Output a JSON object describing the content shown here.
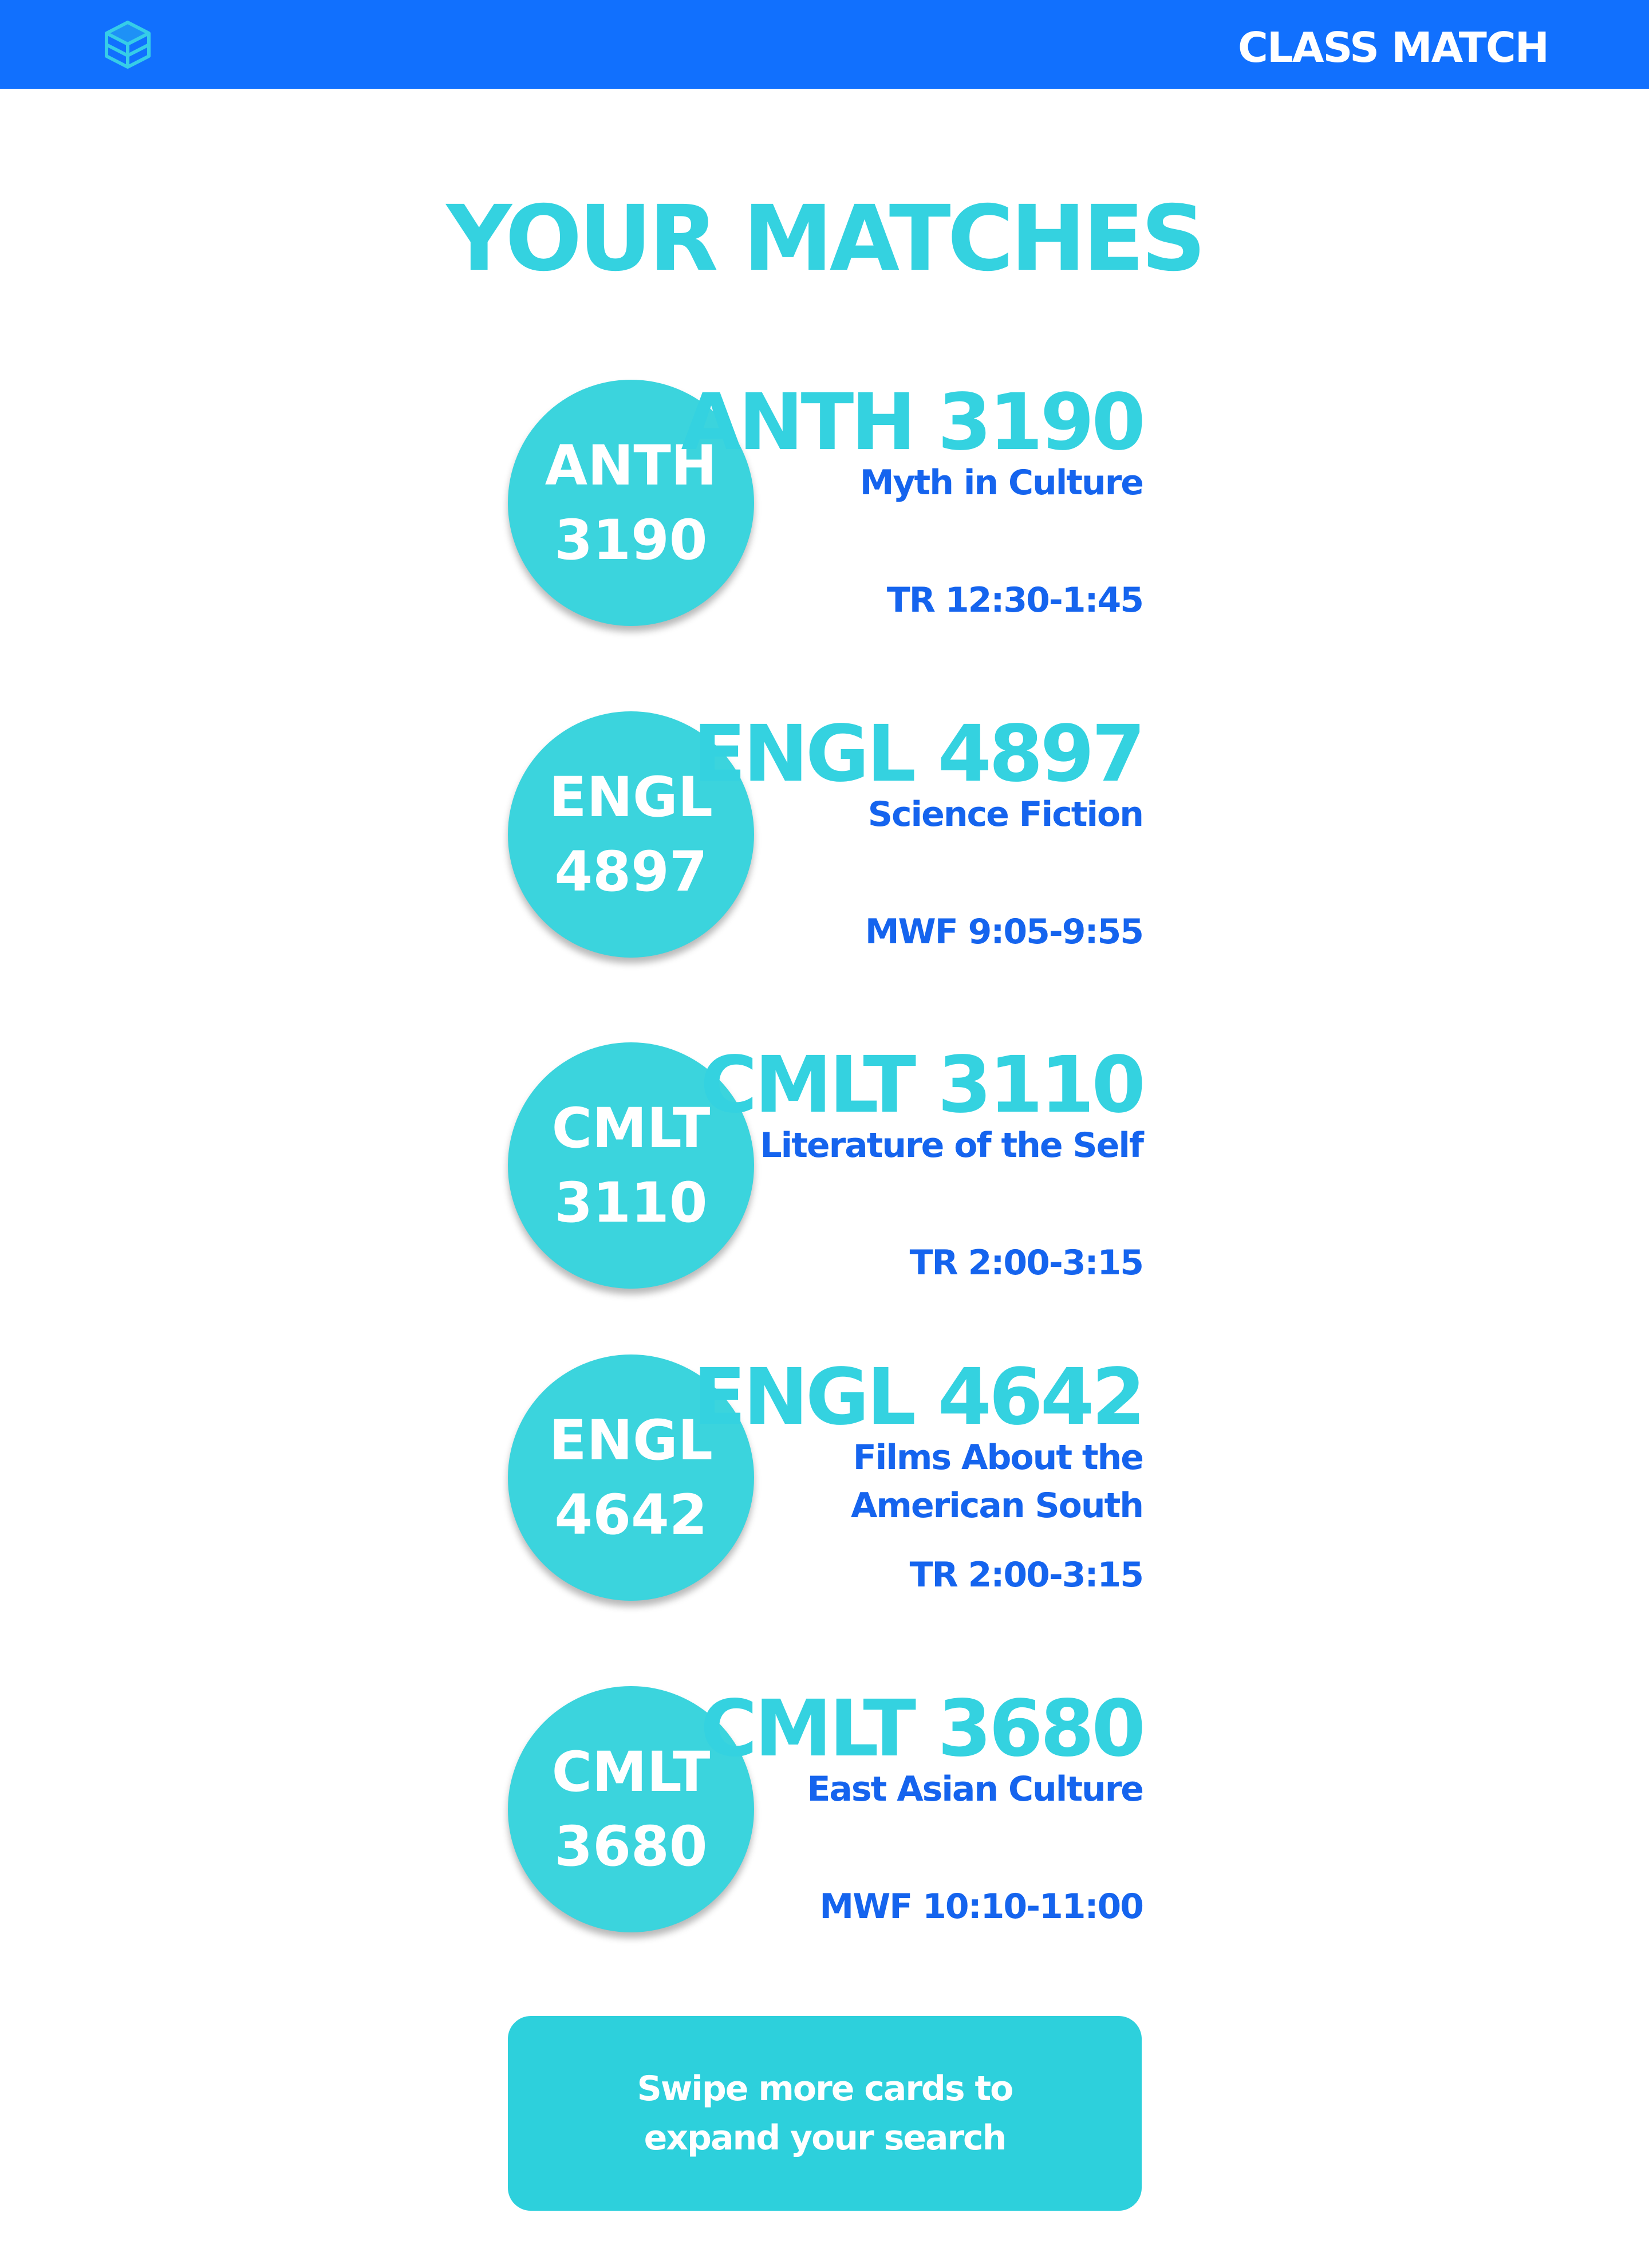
{
  "header": {
    "logo_icon": "stacked-box-logo-icon",
    "title": "CLASS MATCH"
  },
  "page": {
    "title": "YOUR MATCHES"
  },
  "matches": [
    {
      "badge_line1": "ANTH",
      "badge_line2": "3190",
      "code": "ANTH 3190",
      "name": "Myth in Culture",
      "time": "TR 12:30-1:45"
    },
    {
      "badge_line1": "ENGL",
      "badge_line2": "4897",
      "code": "ENGL 4897",
      "name": "Science Fiction",
      "time": "MWF 9:05-9:55"
    },
    {
      "badge_line1": "CMLT",
      "badge_line2": "3110",
      "code": "CMLT 3110",
      "name": "Literature of the Self",
      "time": "TR 2:00-3:15"
    },
    {
      "badge_line1": "ENGL",
      "badge_line2": "4642",
      "code": "ENGL 4642",
      "name": "Films About the American South",
      "time": "TR 2:00-3:15"
    },
    {
      "badge_line1": "CMLT",
      "badge_line2": "3680",
      "code": "CMLT 3680",
      "name": "East Asian Culture",
      "time": "MWF 10:10-11:00"
    }
  ],
  "cta": {
    "line1": "Swipe more cards to",
    "line2": "expand your search"
  },
  "colors": {
    "header_bg": "#1170FE",
    "accent_cyan": "#34D2E0",
    "text_blue": "#1564EE",
    "button_bg": "#2DD0DC"
  }
}
